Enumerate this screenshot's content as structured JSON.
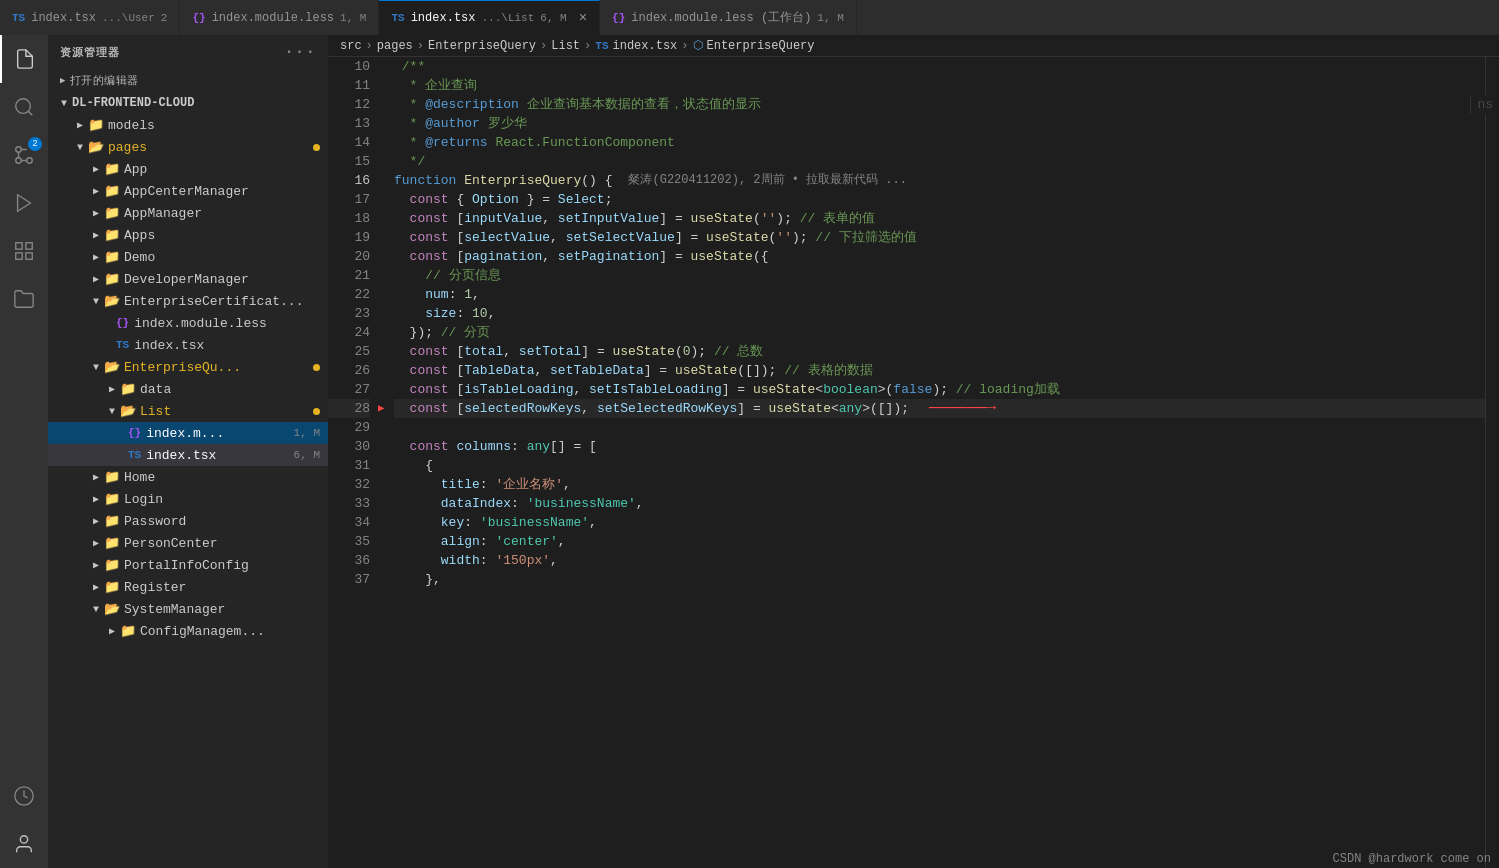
{
  "tabs": [
    {
      "id": "tab1",
      "icon": "TS",
      "icon_type": "ts",
      "name": "index.tsx",
      "path": "...\\User",
      "badge": "2",
      "active": false,
      "modified": false
    },
    {
      "id": "tab2",
      "icon": "{}",
      "icon_type": "less",
      "name": "index.module.less",
      "badge": "1, M",
      "active": false,
      "modified": true
    },
    {
      "id": "tab3",
      "icon": "TS",
      "icon_type": "ts",
      "name": "index.tsx",
      "path": "...\\List",
      "badge": "6, M",
      "active": true,
      "modified": true,
      "hasClose": true
    },
    {
      "id": "tab4",
      "icon": "{}",
      "icon_type": "less",
      "name": "index.module.less (工作台)",
      "badge": "1, M",
      "active": false,
      "modified": true
    }
  ],
  "sidebar": {
    "header": "资源管理器",
    "openedEditors": "打开的编辑器",
    "root": "DL-FRONTEND-CLOUD",
    "items": [
      {
        "id": "models",
        "label": "models",
        "indent": 1,
        "type": "folder-collapsed"
      },
      {
        "id": "pages",
        "label": "pages",
        "indent": 1,
        "type": "folder-expanded",
        "orange": true
      },
      {
        "id": "App",
        "label": "App",
        "indent": 2,
        "type": "folder-collapsed"
      },
      {
        "id": "AppCenterManager",
        "label": "AppCenterManager",
        "indent": 2,
        "type": "folder-collapsed"
      },
      {
        "id": "AppManager",
        "label": "AppManager",
        "indent": 2,
        "type": "folder-collapsed"
      },
      {
        "id": "Apps",
        "label": "Apps",
        "indent": 2,
        "type": "folder-collapsed"
      },
      {
        "id": "Demo",
        "label": "Demo",
        "indent": 2,
        "type": "folder-collapsed"
      },
      {
        "id": "DeveloperManager",
        "label": "DeveloperManager",
        "indent": 2,
        "type": "folder-collapsed"
      },
      {
        "id": "EnterpriseCertificat",
        "label": "EnterpriseCertificat...",
        "indent": 2,
        "type": "folder-expanded"
      },
      {
        "id": "index.module.less",
        "label": "index.module.less",
        "indent": 3,
        "type": "less-file"
      },
      {
        "id": "index.tsx.cert",
        "label": "index.tsx",
        "indent": 3,
        "type": "ts-file"
      },
      {
        "id": "EnterpriseQu",
        "label": "EnterpriseQu...",
        "indent": 2,
        "type": "folder-expanded",
        "orange": true,
        "dot": true
      },
      {
        "id": "data",
        "label": "data",
        "indent": 3,
        "type": "folder-collapsed"
      },
      {
        "id": "List",
        "label": "List",
        "indent": 3,
        "type": "folder-expanded",
        "orange": true,
        "dot": true
      },
      {
        "id": "index.m",
        "label": "index.m...",
        "indent": 4,
        "type": "less-file",
        "badge": "1, M",
        "selected": true
      },
      {
        "id": "index.tsx.list",
        "label": "index.tsx",
        "indent": 4,
        "type": "ts-file",
        "badge": "6, M",
        "active": true
      },
      {
        "id": "Home",
        "label": "Home",
        "indent": 2,
        "type": "folder-collapsed"
      },
      {
        "id": "Login",
        "label": "Login",
        "indent": 2,
        "type": "folder-collapsed"
      },
      {
        "id": "Password",
        "label": "Password",
        "indent": 2,
        "type": "folder-collapsed"
      },
      {
        "id": "PersonCenter",
        "label": "PersonCenter",
        "indent": 2,
        "type": "folder-collapsed"
      },
      {
        "id": "PortalInfoConfig",
        "label": "PortalInfoConfig",
        "indent": 2,
        "type": "folder-collapsed"
      },
      {
        "id": "Register",
        "label": "Register",
        "indent": 2,
        "type": "folder-collapsed"
      },
      {
        "id": "SystemManager",
        "label": "SystemManager",
        "indent": 2,
        "type": "folder-expanded"
      },
      {
        "id": "ConfigManagem",
        "label": "ConfigManagem...",
        "indent": 3,
        "type": "folder-collapsed"
      }
    ]
  },
  "breadcrumb": {
    "parts": [
      "src",
      "pages",
      "EnterpriseQuery",
      "List",
      "index.tsx",
      "EnterpriseQuery"
    ]
  },
  "code": {
    "lines": [
      {
        "num": 10,
        "content": " /**"
      },
      {
        "num": 11,
        "content": "  * 企业查询"
      },
      {
        "num": 12,
        "content": "  * @description 企业查询基本数据的查看，状态值的显示"
      },
      {
        "num": 13,
        "content": "  * @author 罗少华"
      },
      {
        "num": 14,
        "content": "  * @returns React.FunctionComponent"
      },
      {
        "num": 15,
        "content": "  */"
      },
      {
        "num": 16,
        "content": "function EnterpriseQuery() {",
        "annotation": "粲涛(G220411202), 2周前 • 拉取最新代码 ..."
      },
      {
        "num": 17,
        "content": "  const { Option } = Select;"
      },
      {
        "num": 18,
        "content": "  const [inputValue, setInputValue] = useState(''); // 表单的值"
      },
      {
        "num": 19,
        "content": "  const [selectValue, setSelectValue] = useState(''); // 下拉筛选的值"
      },
      {
        "num": 20,
        "content": "  const [pagination, setPagination] = useState({"
      },
      {
        "num": 21,
        "content": "    // 分页信息"
      },
      {
        "num": 22,
        "content": "    num: 1,"
      },
      {
        "num": 23,
        "content": "    size: 10,"
      },
      {
        "num": 24,
        "content": "  }); // 分页"
      },
      {
        "num": 25,
        "content": "  const [total, setTotal] = useState(0); // 总数"
      },
      {
        "num": 26,
        "content": "  const [TableData, setTableData] = useState([]); // 表格的数据"
      },
      {
        "num": 27,
        "content": "  const [isTableLoading, setIsTableLoading] = useState<boolean>(false); // loading加载"
      },
      {
        "num": 28,
        "content": "  const [selectedRowKeys, setSelectedRowKeys] = useState<any>([]);",
        "hasArrow": true
      },
      {
        "num": 29,
        "content": ""
      },
      {
        "num": 30,
        "content": "  const columns: any[] = ["
      },
      {
        "num": 31,
        "content": "    {"
      },
      {
        "num": 32,
        "content": "      title: '企业名称',"
      },
      {
        "num": 33,
        "content": "      dataIndex: 'businessName',"
      },
      {
        "num": 34,
        "content": "      key: 'businessName',"
      },
      {
        "num": 35,
        "content": "      align: 'center',"
      },
      {
        "num": 36,
        "content": "      width: '150px',"
      },
      {
        "num": 37,
        "content": "    },"
      }
    ]
  },
  "status": {
    "text": "CSDN @hardwork come on"
  }
}
